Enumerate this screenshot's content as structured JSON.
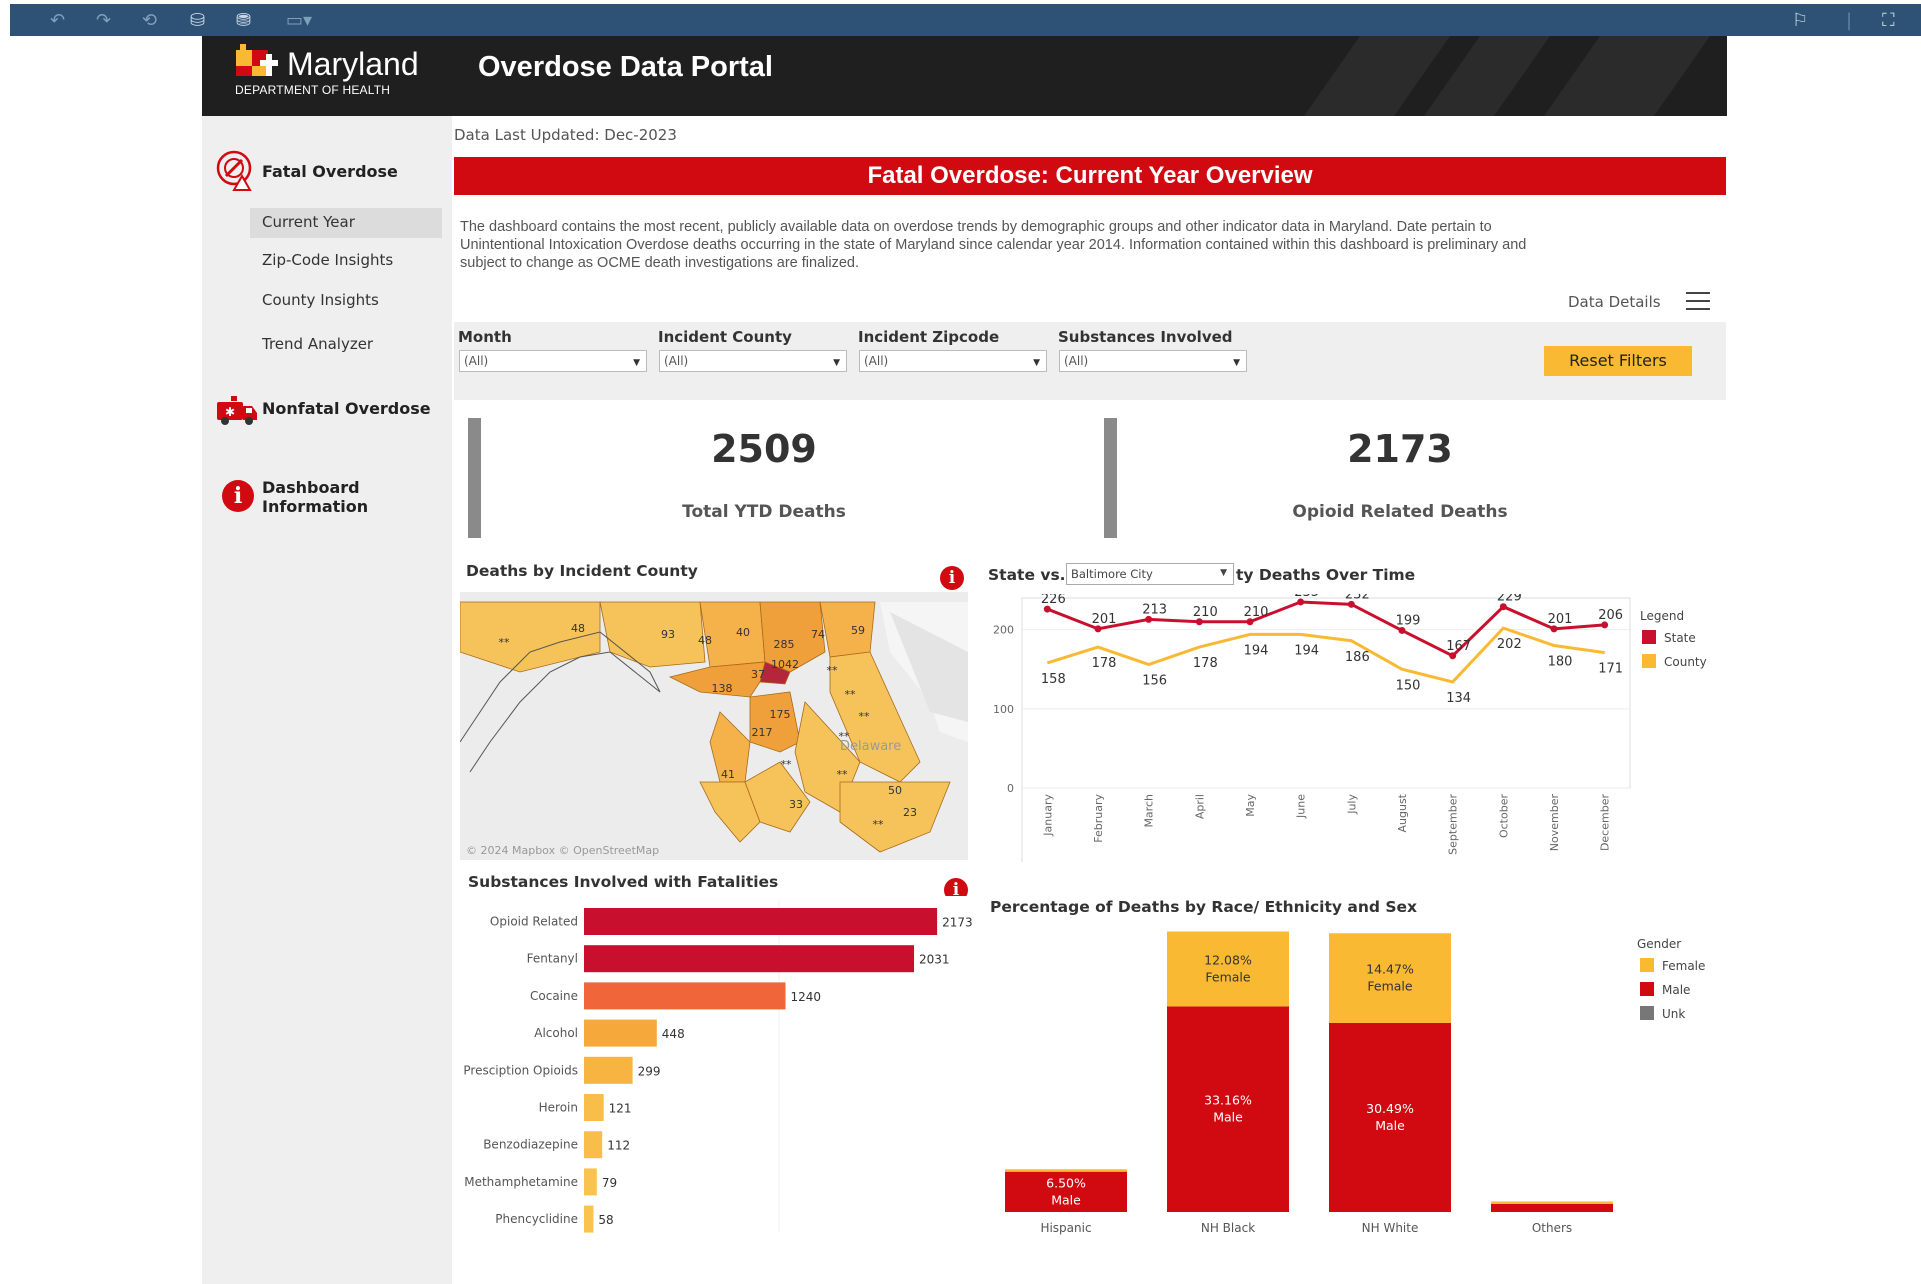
{
  "header": {
    "logo_word": "Maryland",
    "logo_sub": "DEPARTMENT OF HEALTH",
    "portal_title": "Overdose Data Portal"
  },
  "sidebar": {
    "fatal": {
      "label": "Fatal Overdose",
      "items": [
        {
          "label": "Current Year"
        },
        {
          "label": "Zip-Code Insights"
        },
        {
          "label": "County Insights"
        },
        {
          "label": "Trend Analyzer"
        }
      ]
    },
    "nonfatal": {
      "label": "Nonfatal Overdose"
    },
    "dashboard_info": {
      "line1": "Dashboard",
      "line2": "Information"
    }
  },
  "main": {
    "updated": "Data Last Updated: Dec-2023",
    "banner": "Fatal Overdose: Current Year Overview",
    "description_lines": [
      "The dashboard contains the most recent, publicly available data on overdose trends by demographic groups and other indicator data in Maryland.  Date pertain to",
      "Unintentional Intoxication Overdose deaths occurring in the state of Maryland since calendar year 2014. Information contained within this dashboard is preliminary and",
      "subject to change as OCME death investigations are finalized."
    ],
    "data_details": "Data Details",
    "filters": [
      {
        "label": "Month",
        "value": "(All)"
      },
      {
        "label": "Incident County",
        "value": "(All)"
      },
      {
        "label": "Incident Zipcode",
        "value": "(All)"
      },
      {
        "label": "Substances Involved",
        "value": "(All)"
      }
    ],
    "reset_label": "Reset Filters",
    "kpis": [
      {
        "value": "2509",
        "label": "Total YTD Deaths"
      },
      {
        "value": "2173",
        "label": "Opioid Related Deaths"
      }
    ],
    "map": {
      "title": "Deaths by Incident County",
      "credit": "© 2024 Mapbox  © OpenStreetMap",
      "state_label": "Delaware",
      "county_labels": [
        "**",
        "48",
        "93",
        "48",
        "40",
        "285",
        "74",
        "59",
        "1042",
        "37",
        "138",
        "175",
        "217",
        "41",
        "33",
        "50",
        "23",
        "**",
        "**",
        "**",
        "**",
        "**",
        "**",
        "**"
      ]
    },
    "line_panel": {
      "title_prefix": "State vs.",
      "title_suffix": "ty Deaths Over Time",
      "county_select": "Baltimore City"
    },
    "substances_title": "Substances Involved with Fatalities",
    "race_title": "Percentage of Deaths by Race/ Ethnicity and Sex",
    "colors": {
      "red": "#d10a11",
      "gold": "#f9b933",
      "crimson": "#c8102e"
    }
  },
  "chart_data": [
    {
      "type": "line",
      "title": "State vs. ty Deaths Over Time",
      "x": [
        "January",
        "February",
        "March",
        "April",
        "May",
        "June",
        "July",
        "August",
        "September",
        "October",
        "November",
        "December"
      ],
      "ylim": [
        0,
        240
      ],
      "yticks": [
        0,
        100,
        200
      ],
      "legend_title": "Legend",
      "legend_position": "right",
      "series": [
        {
          "name": "State",
          "color": "#c8102e",
          "values": [
            226,
            201,
            213,
            210,
            210,
            235,
            232,
            199,
            167,
            229,
            201,
            206
          ]
        },
        {
          "name": "County",
          "color": "#f9b933",
          "values": [
            158,
            178,
            156,
            178,
            194,
            194,
            186,
            150,
            134,
            202,
            180,
            171
          ]
        }
      ]
    },
    {
      "type": "bar",
      "orientation": "horizontal",
      "title": "Substances Involved with Fatalities",
      "categories": [
        "Opioid Related",
        "Fentanyl",
        "Cocaine",
        "Alcohol",
        "Presciption Opioids",
        "Heroin",
        "Benzodiazepine",
        "Methamphetamine",
        "Phencyclidine"
      ],
      "values": [
        2173,
        2031,
        1240,
        448,
        299,
        121,
        112,
        79,
        58
      ],
      "colors": [
        "#c8102e",
        "#c8102e",
        "#f0653a",
        "#f7a83a",
        "#f8b440",
        "#f9be4a",
        "#f9be4a",
        "#f9c34f",
        "#f9c34f"
      ]
    },
    {
      "type": "bar",
      "stacked": true,
      "title": "Percentage of Deaths by Race/ Ethnicity and Sex",
      "categories": [
        "Hispanic",
        "NH Black",
        "NH White",
        "Others"
      ],
      "legend_title": "Gender",
      "legend_position": "right",
      "series": [
        {
          "name": "Male",
          "color": "#d10a11",
          "values": [
            6.5,
            33.16,
            30.49,
            1.3
          ],
          "labels": [
            "6.50%\nMale",
            "33.16%\nMale",
            "30.49%\nMale",
            ""
          ]
        },
        {
          "name": "Female",
          "color": "#f9b933",
          "values": [
            0.4,
            12.08,
            14.47,
            0.4
          ],
          "labels": [
            "",
            "12.08%\nFemale",
            "14.47%\nFemale",
            ""
          ]
        },
        {
          "name": "Unk",
          "color": "#777777",
          "values": [
            0,
            0,
            0,
            0
          ]
        }
      ]
    }
  ]
}
